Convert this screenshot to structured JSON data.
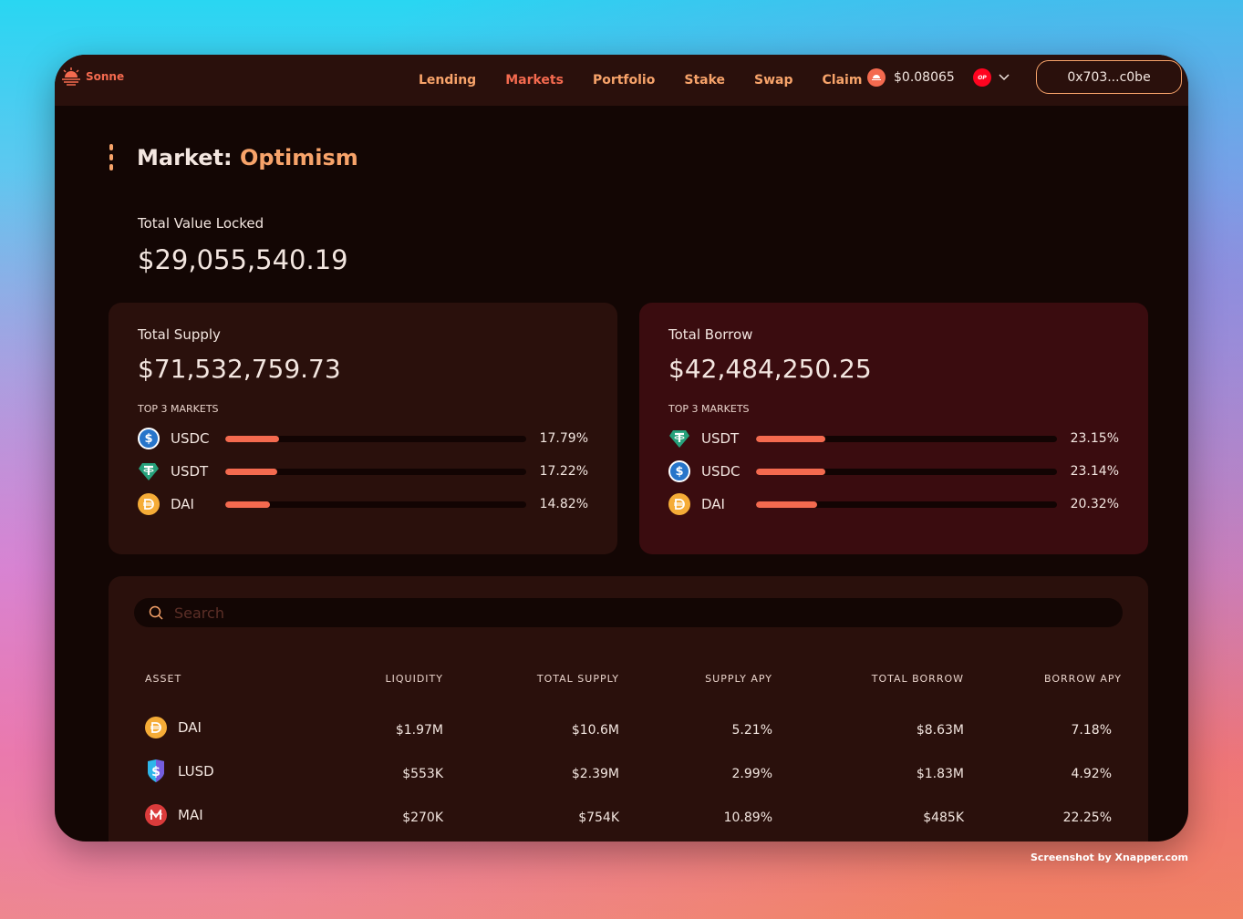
{
  "app": {
    "name": "Sonne"
  },
  "nav": {
    "items": [
      "Lending",
      "Markets",
      "Portfolio",
      "Stake",
      "Swap",
      "Claim"
    ],
    "active": "Markets"
  },
  "header": {
    "price": "$0.08065",
    "network_badge": "OP",
    "wallet": "0x703...c0be"
  },
  "market": {
    "prefix": "Market:",
    "name": "Optimism"
  },
  "tvl": {
    "label": "Total Value Locked",
    "value": "$29,055,540.19"
  },
  "supply": {
    "label": "Total Supply",
    "value": "$71,532,759.73",
    "top_label": "TOP 3 MARKETS",
    "markets": [
      {
        "asset": "USDC",
        "pct": "17.79%",
        "fill": 17.79
      },
      {
        "asset": "USDT",
        "pct": "17.22%",
        "fill": 17.22
      },
      {
        "asset": "DAI",
        "pct": "14.82%",
        "fill": 14.82
      }
    ]
  },
  "borrow": {
    "label": "Total Borrow",
    "value": "$42,484,250.25",
    "top_label": "TOP 3 MARKETS",
    "markets": [
      {
        "asset": "USDT",
        "pct": "23.15%",
        "fill": 23.15
      },
      {
        "asset": "USDC",
        "pct": "23.14%",
        "fill": 23.14
      },
      {
        "asset": "DAI",
        "pct": "20.32%",
        "fill": 20.32
      }
    ]
  },
  "search": {
    "placeholder": "Search"
  },
  "table": {
    "headers": [
      "ASSET",
      "LIQUIDITY",
      "TOTAL SUPPLY",
      "SUPPLY APY",
      "TOTAL BORROW",
      "BORROW APY"
    ],
    "rows": [
      {
        "asset": "DAI",
        "liquidity": "$1.97M",
        "total_supply": "$10.6M",
        "supply_apy": "5.21%",
        "total_borrow": "$8.63M",
        "borrow_apy": "7.18%"
      },
      {
        "asset": "LUSD",
        "liquidity": "$553K",
        "total_supply": "$2.39M",
        "supply_apy": "2.99%",
        "total_borrow": "$1.83M",
        "borrow_apy": "4.92%"
      },
      {
        "asset": "MAI",
        "liquidity": "$270K",
        "total_supply": "$754K",
        "supply_apy": "10.89%",
        "total_borrow": "$485K",
        "borrow_apy": "22.25%"
      }
    ]
  },
  "watermark": "Screenshot by Xnapper.com",
  "colors": {
    "accent": "#f46a4f",
    "accent_light": "#f7a36a",
    "bg": "#130604",
    "card": "#2a100c",
    "borrow_card": "#3a0c0f"
  }
}
